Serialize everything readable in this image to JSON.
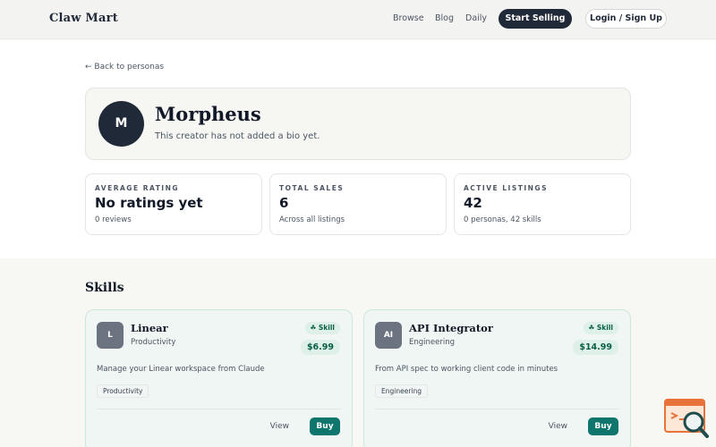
{
  "header": {
    "brand": "Claw Mart",
    "nav": [
      "Browse",
      "Blog",
      "Daily"
    ],
    "start_selling": "Start Selling",
    "login": "Login / Sign Up"
  },
  "profile": {
    "back_link": "← Back to personas",
    "avatar_initial": "M",
    "name": "Morpheus",
    "bio": "This creator has not added a bio yet."
  },
  "stats": [
    {
      "label": "AVERAGE RATING",
      "value": "No ratings yet",
      "sub": "0 reviews"
    },
    {
      "label": "TOTAL SALES",
      "value": "6",
      "sub": "Across all listings"
    },
    {
      "label": "ACTIVE LISTINGS",
      "value": "42",
      "sub": "0 personas, 42 skills"
    }
  ],
  "skills_section": {
    "title": "Skills",
    "items": [
      {
        "icon_text": "L",
        "name": "Linear",
        "category": "Productivity",
        "badge": "Skill",
        "price": "$6.99",
        "description": "Manage your Linear workspace from Claude",
        "tag": "Productivity",
        "view_label": "View",
        "buy_label": "Buy"
      },
      {
        "icon_text": "AI",
        "name": "API Integrator",
        "category": "Engineering",
        "badge": "Skill",
        "price": "$14.99",
        "description": "From API spec to working client code in minutes",
        "tag": "Engineering",
        "view_label": "View",
        "buy_label": "Buy"
      }
    ]
  },
  "colors": {
    "accent": "#0f766e",
    "dark": "#1f2937",
    "badge_bg": "#dff0e8"
  },
  "icons": {
    "badge_icon": "leaf-icon",
    "help_widget": "chat-search-icon"
  }
}
